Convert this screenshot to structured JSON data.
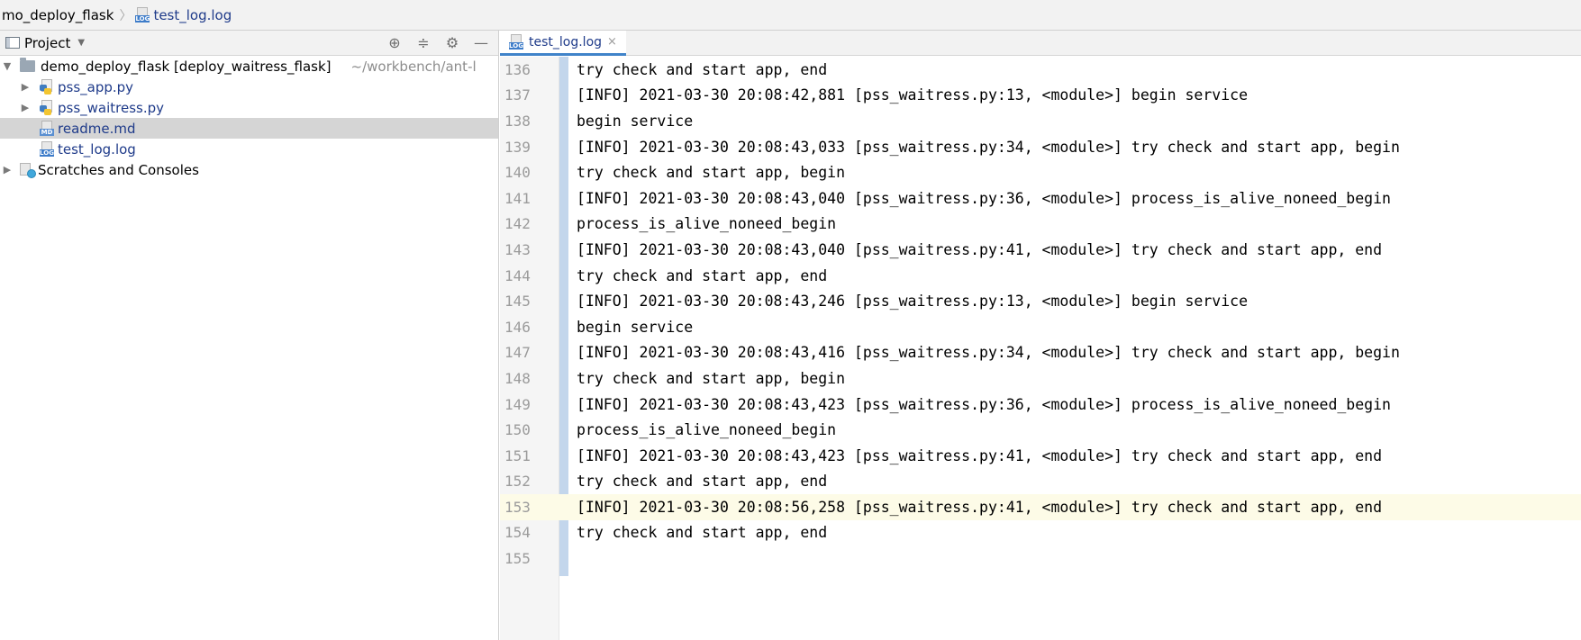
{
  "breadcrumb": {
    "project": "mo_deploy_flask",
    "file": "test_log.log",
    "file_icon": "log-file-icon"
  },
  "project_panel": {
    "title": "Project",
    "tools": [
      "locate-icon",
      "collapse-icon",
      "gear-icon",
      "minimize-icon"
    ],
    "tree": {
      "root": {
        "name": "demo_deploy_flask [deploy_waitress_flask]",
        "path": "~/workbench/ant-l"
      },
      "files": [
        {
          "name": "pss_app.py",
          "icon": "python-file-icon"
        },
        {
          "name": "pss_waitress.py",
          "icon": "python-file-icon"
        },
        {
          "name": "readme.md",
          "icon": "markdown-file-icon",
          "selected": true
        },
        {
          "name": "test_log.log",
          "icon": "log-file-icon"
        }
      ],
      "scratches": "Scratches and Consoles"
    }
  },
  "editor": {
    "tab": {
      "label": "test_log.log",
      "close": "×"
    },
    "current_line": 153,
    "lines": [
      {
        "n": "136",
        "text": "try check and start app, end"
      },
      {
        "n": "137",
        "text": "[INFO] 2021-03-30 20:08:42,881 [pss_waitress.py:13, <module>] begin service"
      },
      {
        "n": "138",
        "text": "begin service"
      },
      {
        "n": "139",
        "text": "[INFO] 2021-03-30 20:08:43,033 [pss_waitress.py:34, <module>] try check and start app, begin"
      },
      {
        "n": "140",
        "text": "try check and start app, begin"
      },
      {
        "n": "141",
        "text": "[INFO] 2021-03-30 20:08:43,040 [pss_waitress.py:36, <module>] process_is_alive_noneed_begin"
      },
      {
        "n": "142",
        "text": "process_is_alive_noneed_begin"
      },
      {
        "n": "143",
        "text": "[INFO] 2021-03-30 20:08:43,040 [pss_waitress.py:41, <module>] try check and start app, end"
      },
      {
        "n": "144",
        "text": "try check and start app, end"
      },
      {
        "n": "145",
        "text": "[INFO] 2021-03-30 20:08:43,246 [pss_waitress.py:13, <module>] begin service"
      },
      {
        "n": "146",
        "text": "begin service"
      },
      {
        "n": "147",
        "text": "[INFO] 2021-03-30 20:08:43,416 [pss_waitress.py:34, <module>] try check and start app, begin"
      },
      {
        "n": "148",
        "text": "try check and start app, begin"
      },
      {
        "n": "149",
        "text": "[INFO] 2021-03-30 20:08:43,423 [pss_waitress.py:36, <module>] process_is_alive_noneed_begin"
      },
      {
        "n": "150",
        "text": "process_is_alive_noneed_begin"
      },
      {
        "n": "151",
        "text": "[INFO] 2021-03-30 20:08:43,423 [pss_waitress.py:41, <module>] try check and start app, end"
      },
      {
        "n": "152",
        "text": "try check and start app, end"
      },
      {
        "n": "153",
        "text": "[INFO] 2021-03-30 20:08:56,258 [pss_waitress.py:41, <module>] try check and start app, end"
      },
      {
        "n": "154",
        "text": "try check and start app, end"
      },
      {
        "n": "155",
        "text": ""
      }
    ]
  },
  "colors": {
    "file_link": "#1f3b8a",
    "tab_underline": "#4083c9",
    "current_line_bg": "#fdfbe7",
    "change_bar": "#c3d6ec",
    "selected_row": "#d5d5d5"
  }
}
